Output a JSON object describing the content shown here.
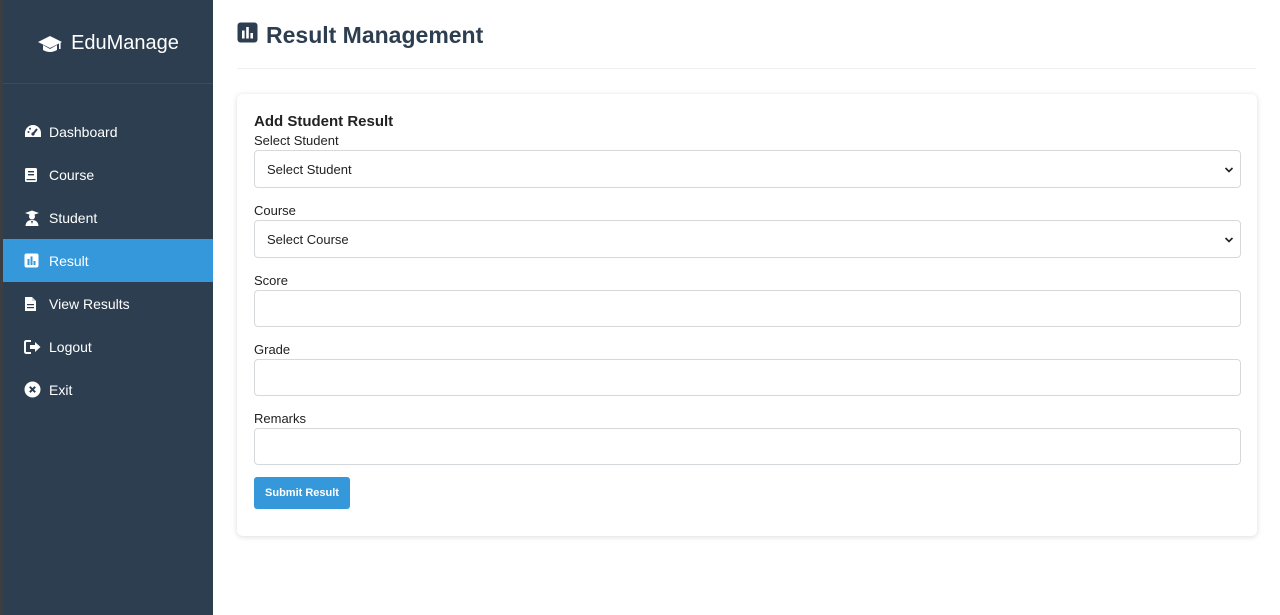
{
  "brand": {
    "name": "EduManage",
    "icon": "graduation-cap-icon"
  },
  "sidebar": {
    "items": [
      {
        "label": "Dashboard",
        "icon": "gauge-icon",
        "active": false
      },
      {
        "label": "Course",
        "icon": "book-icon",
        "active": false
      },
      {
        "label": "Student",
        "icon": "user-graduate-icon",
        "active": false
      },
      {
        "label": "Result",
        "icon": "chart-square-icon",
        "active": true
      },
      {
        "label": "View Results",
        "icon": "file-icon",
        "active": false
      },
      {
        "label": "Logout",
        "icon": "sign-out-icon",
        "active": false
      },
      {
        "label": "Exit",
        "icon": "close-circle-icon",
        "active": false
      }
    ]
  },
  "header": {
    "title": "Result Management",
    "icon": "chart-square-icon"
  },
  "form": {
    "title": "Add Student Result",
    "student_label": "Select Student",
    "student_selected": "Select Student",
    "course_label": "Course",
    "course_selected": "Select Course",
    "score_label": "Score",
    "score_value": "",
    "grade_label": "Grade",
    "grade_value": "",
    "remarks_label": "Remarks",
    "remarks_value": "",
    "submit_label": "Submit Result"
  },
  "colors": {
    "sidebar_bg": "#2c3e50",
    "accent": "#3498db",
    "header_text": "#2c3e50"
  }
}
